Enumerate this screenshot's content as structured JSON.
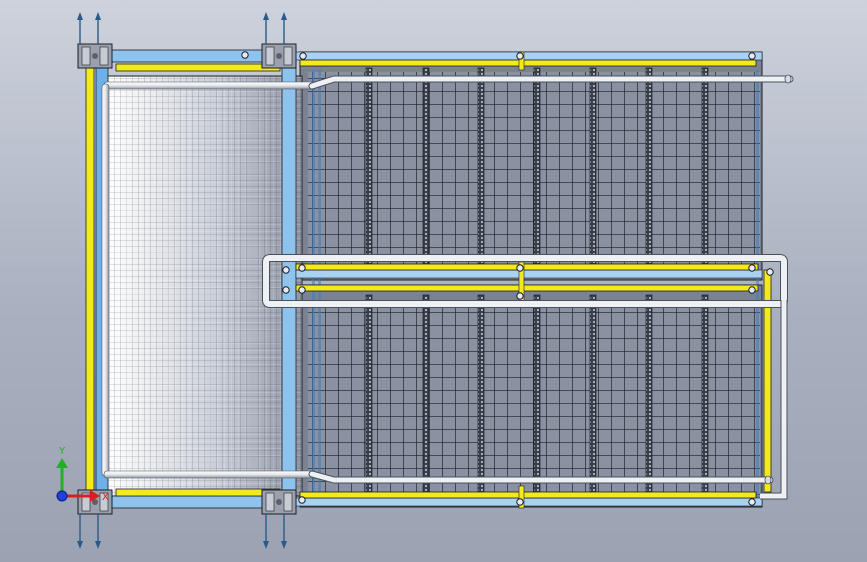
{
  "viewport": {
    "background_top": "#cdd2dc",
    "background_bottom": "#9ba2b2"
  },
  "model": {
    "colors": {
      "yellow_rail": "#f2ea1c",
      "blue_frame": "#6fb0e8",
      "light_blue_frame": "#a9d2f2",
      "pipe": "#eef0f3",
      "mesh_dark": "#20242c",
      "mesh_light": "#eef0f3",
      "plate_fill": "#7e8593"
    }
  },
  "triad": {
    "x_label": "X",
    "y_label": "Y",
    "x_color": "#d62020",
    "y_color": "#24b024",
    "z_color": "#2040e0",
    "icon": "coordinate-triad-icon"
  }
}
